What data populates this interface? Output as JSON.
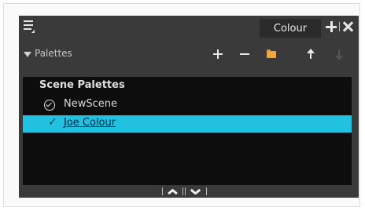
{
  "window": {
    "tab_label": "Colour"
  },
  "toolbar": {
    "palettes_label": "Palettes"
  },
  "list": {
    "group_header": "Scene Palettes",
    "items": [
      {
        "label": "NewScene",
        "selected": false,
        "state_icon": "circle-check-icon"
      },
      {
        "label": "Joe Colour",
        "selected": true,
        "state_icon": "checkmark-icon"
      }
    ],
    "checkmark_glyph": "✓"
  },
  "colors": {
    "panel_bg": "#3a3a3a",
    "list_bg": "#0d0d0d",
    "selection": "#21c2e1",
    "folder": "#f0a63a"
  }
}
